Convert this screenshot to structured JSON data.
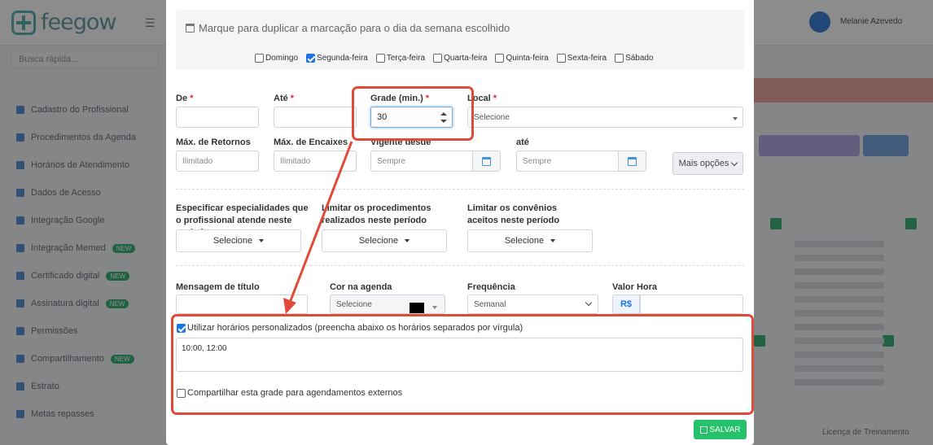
{
  "app": {
    "logo_text": "feegow",
    "user_name": "Melanie Azevedo",
    "search_placeholder": "Busca rápida...",
    "sidebar": [
      {
        "label": "Cadastro do Profissional",
        "badge": ""
      },
      {
        "label": "Procedimentos da Agenda",
        "badge": ""
      },
      {
        "label": "Horários de Atendimento",
        "badge": ""
      },
      {
        "label": "Dados de Acesso",
        "badge": ""
      },
      {
        "label": "Integração Google",
        "badge": ""
      },
      {
        "label": "Integração Memed",
        "badge": "NEW"
      },
      {
        "label": "Certificado digital",
        "badge": "NEW"
      },
      {
        "label": "Assinatura digital",
        "badge": "NEW"
      },
      {
        "label": "Permissões",
        "badge": ""
      },
      {
        "label": "Compartilhamento",
        "badge": "NEW"
      },
      {
        "label": "Estrato",
        "badge": ""
      },
      {
        "label": "Metas repasses",
        "badge": ""
      }
    ],
    "footer_text": "Licença de Treinamento"
  },
  "modal": {
    "duplicate_title": "Marque para duplicar a marcação para o dia da semana escolhido",
    "days": [
      {
        "label": "Domingo",
        "checked": false
      },
      {
        "label": "Segunda-feira",
        "checked": true
      },
      {
        "label": "Terça-feira",
        "checked": false
      },
      {
        "label": "Quarta-feira",
        "checked": false
      },
      {
        "label": "Quinta-feira",
        "checked": false
      },
      {
        "label": "Sexta-feira",
        "checked": false
      },
      {
        "label": "Sábado",
        "checked": false
      }
    ],
    "de_label": "De",
    "ate_label": "Até",
    "grade_label": "Grade (min.)",
    "grade_value": "30",
    "local_label": "Local",
    "local_value": "Selecione",
    "required_mark": "*",
    "max_retornos_label": "Máx. de Retornos",
    "max_retornos_placeholder": "Ilimitado",
    "max_encaixes_label": "Máx. de Encaixes",
    "max_encaixes_placeholder": "Ilimitado",
    "vigente_label": "Vigente desde",
    "vigente_placeholder": "Sempre",
    "vig_ate_label": "até",
    "vig_ate_placeholder": "Sempre",
    "mais_opcoes": "Mais opções",
    "especialidades_label": "Especificar especialidades que o profissional atende neste período",
    "procedimentos_label": "Limitar os procedimentos realizados neste período",
    "convenios_label": "Limitar os convênios aceitos neste período",
    "select_placeholder": "Selecione",
    "mensagem_label": "Mensagem de título",
    "cor_label": "Cor na agenda",
    "cor_value": "Selecione",
    "cor_swatch": "#000000",
    "frequencia_label": "Frequência",
    "frequencia_value": "Semanal",
    "valor_hora_label": "Valor Hora",
    "currency": "R$",
    "custom_times_label": "Utilizar horários personalizados (preencha abaixo os horários separados por vírgula)",
    "custom_times_checked": true,
    "custom_times_value": "10:00, 12:00",
    "share_label": "Compartilhar esta grade para agendamentos externos",
    "share_checked": false,
    "save_label": "SALVAR"
  },
  "colors": {
    "accent": "#1a73e8",
    "save": "#23c26b",
    "annotation": "#e04a37"
  }
}
